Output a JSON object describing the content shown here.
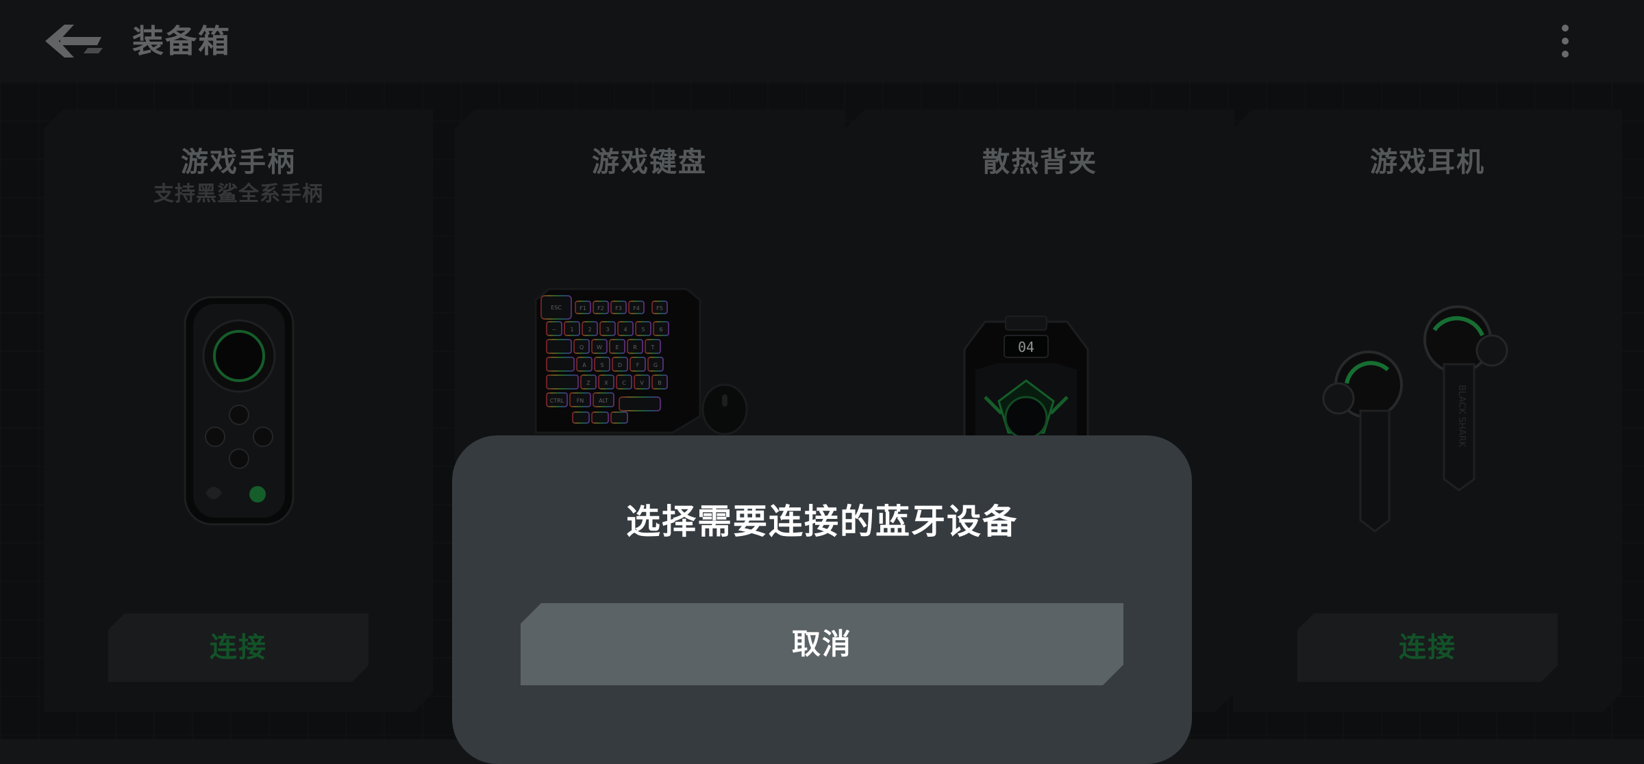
{
  "header": {
    "title": "装备箱",
    "back_icon": "back-arrow-icon",
    "more_icon": "more-vertical-icon"
  },
  "cards": [
    {
      "title": "游戏手柄",
      "subtitle": "支持黑鲨全系手柄",
      "connect_label": "连接",
      "image": "gamepad-image"
    },
    {
      "title": "游戏键盘",
      "subtitle": "",
      "connect_label": "",
      "image": "keyboard-image"
    },
    {
      "title": "散热背夹",
      "subtitle": "",
      "connect_label": "",
      "image": "cooler-image"
    },
    {
      "title": "游戏耳机",
      "subtitle": "",
      "connect_label": "连接",
      "image": "earbuds-image"
    }
  ],
  "keyboard_keys": {
    "esc": "ESC",
    "row1": [
      "F1",
      "F2",
      "F3",
      "F4",
      "F5"
    ],
    "row2": [
      "~",
      "1",
      "2",
      "3",
      "4",
      "5",
      "6"
    ],
    "row3": [
      "Q",
      "W",
      "E",
      "R",
      "T"
    ],
    "row4": [
      "A",
      "S",
      "D",
      "F",
      "G"
    ],
    "row5": [
      "Z",
      "X",
      "C",
      "V",
      "B"
    ],
    "ctrl": "CTRL",
    "fn": "FN",
    "alt": "ALT"
  },
  "cooler_display": "04",
  "earbud_brand": "BLACK SHARK",
  "dialog": {
    "title": "选择需要连接的蓝牙设备",
    "cancel_label": "取消"
  },
  "colors": {
    "accent_green": "#1d7a3c",
    "background": "#131517",
    "dialog_bg": "#363b40",
    "cancel_bg": "#5b6366"
  }
}
